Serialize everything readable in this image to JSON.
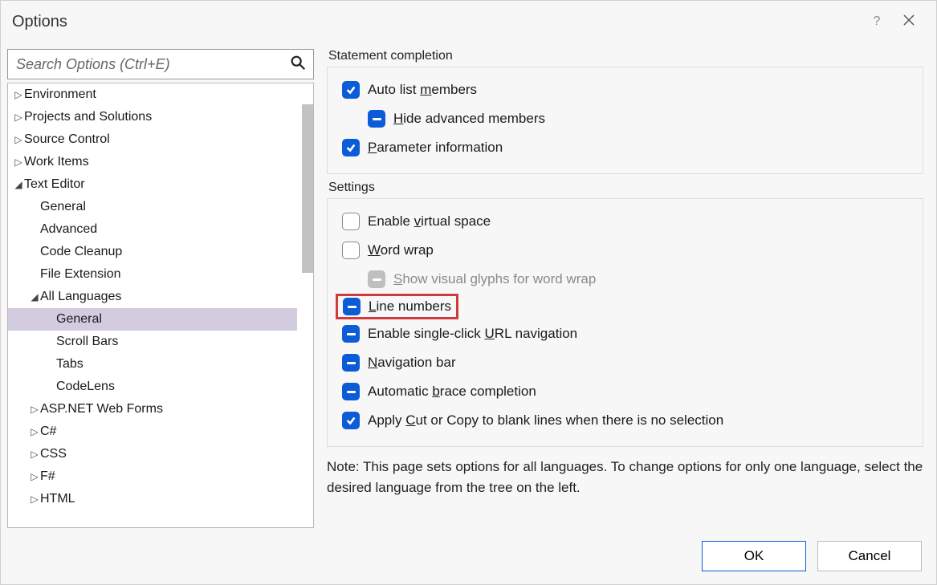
{
  "title": "Options",
  "search": {
    "placeholder": "Search Options (Ctrl+E)"
  },
  "tree": [
    {
      "label": "Environment",
      "indent": 0,
      "expand": "collapsed"
    },
    {
      "label": "Projects and Solutions",
      "indent": 0,
      "expand": "collapsed"
    },
    {
      "label": "Source Control",
      "indent": 0,
      "expand": "collapsed"
    },
    {
      "label": "Work Items",
      "indent": 0,
      "expand": "collapsed"
    },
    {
      "label": "Text Editor",
      "indent": 0,
      "expand": "expanded"
    },
    {
      "label": "General",
      "indent": 1,
      "expand": "none"
    },
    {
      "label": "Advanced",
      "indent": 1,
      "expand": "none"
    },
    {
      "label": "Code Cleanup",
      "indent": 1,
      "expand": "none"
    },
    {
      "label": "File Extension",
      "indent": 1,
      "expand": "none"
    },
    {
      "label": "All Languages",
      "indent": 1,
      "expand": "expanded"
    },
    {
      "label": "General",
      "indent": 2,
      "expand": "none",
      "selected": true
    },
    {
      "label": "Scroll Bars",
      "indent": 2,
      "expand": "none"
    },
    {
      "label": "Tabs",
      "indent": 2,
      "expand": "none"
    },
    {
      "label": "CodeLens",
      "indent": 2,
      "expand": "none"
    },
    {
      "label": "ASP.NET Web Forms",
      "indent": 1,
      "expand": "collapsed"
    },
    {
      "label": "C#",
      "indent": 1,
      "expand": "collapsed"
    },
    {
      "label": "CSS",
      "indent": 1,
      "expand": "collapsed"
    },
    {
      "label": "F#",
      "indent": 1,
      "expand": "collapsed"
    },
    {
      "label": "HTML",
      "indent": 1,
      "expand": "collapsed"
    }
  ],
  "groups": {
    "statement_completion": {
      "title": "Statement completion",
      "auto_list_members": {
        "text": "Auto list members",
        "u": "m",
        "state": "checked"
      },
      "hide_advanced_members": {
        "text": "Hide advanced members",
        "u": "H",
        "state": "indeterminate"
      },
      "parameter_information": {
        "text": "Parameter information",
        "u": "P",
        "state": "checked"
      }
    },
    "settings": {
      "title": "Settings",
      "enable_virtual_space": {
        "text": "Enable virtual space",
        "u": "v",
        "state": "unchecked"
      },
      "word_wrap": {
        "text": "Word wrap",
        "u": "W",
        "state": "unchecked"
      },
      "show_visual_glyphs": {
        "text": "Show visual glyphs for word wrap",
        "u": "S",
        "state": "disabled"
      },
      "line_numbers": {
        "text": "Line numbers",
        "u": "L",
        "state": "indeterminate",
        "highlighted": true
      },
      "single_click_url": {
        "text": "Enable single-click URL navigation",
        "u": "U",
        "state": "indeterminate"
      },
      "navigation_bar": {
        "text": "Navigation bar",
        "u": "N",
        "state": "indeterminate"
      },
      "brace_completion": {
        "text": "Automatic brace completion",
        "u": "b",
        "state": "indeterminate"
      },
      "cut_copy_blank": {
        "text": "Apply Cut or Copy to blank lines when there is no selection",
        "u": "C",
        "state": "checked"
      }
    }
  },
  "note": "Note: This page sets options for all languages. To change options for only one language, select the desired language from the tree on the left.",
  "buttons": {
    "ok": "OK",
    "cancel": "Cancel"
  }
}
